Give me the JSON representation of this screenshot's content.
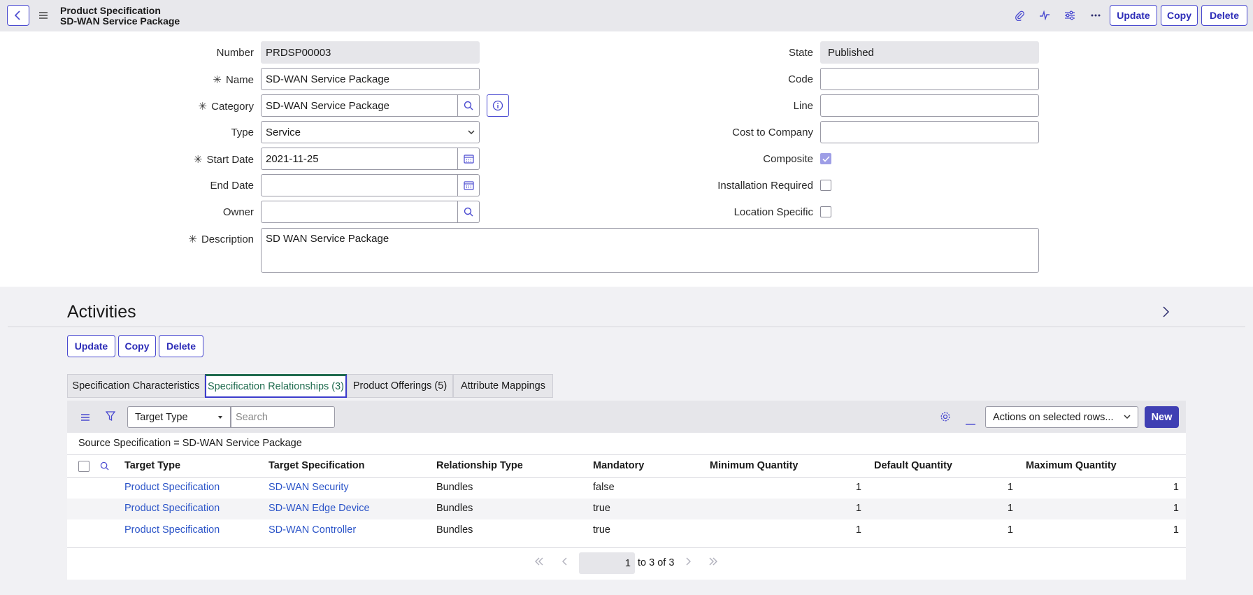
{
  "header": {
    "title_line1": "Product Specification",
    "title_line2": "SD-WAN Service Package",
    "update_label": "Update",
    "copy_label": "Copy",
    "delete_label": "Delete"
  },
  "form": {
    "number_label": "Number",
    "number_value": "PRDSP00003",
    "name_label": "Name",
    "name_value": "SD-WAN Service Package",
    "category_label": "Category",
    "category_value": "SD-WAN Service Package",
    "type_label": "Type",
    "type_value": "Service",
    "start_date_label": "Start Date",
    "start_date_value": "2021-11-25",
    "end_date_label": "End Date",
    "end_date_value": "",
    "owner_label": "Owner",
    "owner_value": "",
    "description_label": "Description",
    "description_value": "SD WAN Service Package",
    "state_label": "State",
    "state_value": "Published",
    "code_label": "Code",
    "code_value": "",
    "line_label": "Line",
    "line_value": "",
    "cost_label": "Cost to Company",
    "cost_value": "",
    "composite_label": "Composite",
    "composite_checked": true,
    "installation_label": "Installation Required",
    "installation_checked": false,
    "location_label": "Location Specific",
    "location_checked": false
  },
  "activities": {
    "title": "Activities",
    "update_label": "Update",
    "copy_label": "Copy",
    "delete_label": "Delete"
  },
  "tabs": [
    {
      "label": "Specification Characteristics",
      "active": false
    },
    {
      "label": "Specification Relationships (3)",
      "active": true
    },
    {
      "label": "Product Offerings (5)",
      "active": false
    },
    {
      "label": "Attribute Mappings",
      "active": false
    }
  ],
  "list": {
    "search_field": "Target Type",
    "search_placeholder": "Search",
    "actions_label": "Actions on selected rows...",
    "new_label": "New",
    "filter_text": "Source Specification = SD-WAN Service Package",
    "columns": [
      "Target Type",
      "Target Specification",
      "Relationship Type",
      "Mandatory",
      "Minimum Quantity",
      "Default Quantity",
      "Maximum Quantity"
    ],
    "rows": [
      {
        "target_type": "Product Specification",
        "target_spec": "SD-WAN Security",
        "rel_type": "Bundles",
        "mandatory": "false",
        "min": "1",
        "def": "1",
        "max": "1"
      },
      {
        "target_type": "Product Specification",
        "target_spec": "SD-WAN Edge Device",
        "rel_type": "Bundles",
        "mandatory": "true",
        "min": "1",
        "def": "1",
        "max": "1"
      },
      {
        "target_type": "Product Specification",
        "target_spec": "SD-WAN Controller",
        "rel_type": "Bundles",
        "mandatory": "true",
        "min": "1",
        "def": "1",
        "max": "1"
      }
    ],
    "page_value": "1",
    "page_text": "to 3 of 3"
  },
  "colors": {
    "accent": "#4a4ad0",
    "link": "#2b54c8",
    "active_tab": "#1f6b4e"
  }
}
